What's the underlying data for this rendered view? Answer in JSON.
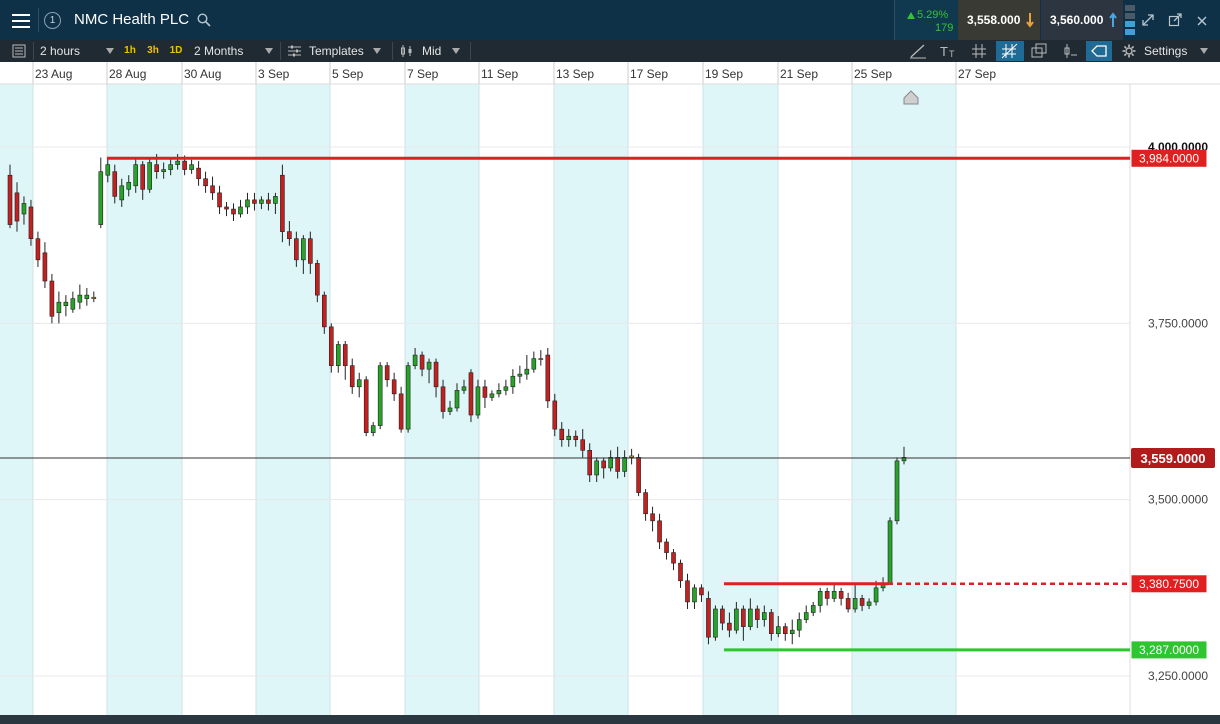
{
  "header": {
    "menu_icon": "hamburger-menu-icon",
    "window_number": "1",
    "title": "NMC Health PLC",
    "search_icon": "search-icon",
    "change_percent": "5.29%",
    "change_points": "179",
    "sell_price": "3,558.000",
    "buy_price": "3,560.000",
    "colors": {
      "bg": "#0e3147",
      "up": "#36c236",
      "sell": "#e8a23c",
      "buy": "#4aa8e0"
    }
  },
  "toolbar": {
    "interval": "2 hours",
    "timeframes": [
      "1h",
      "3h",
      "1D"
    ],
    "range": "2 Months",
    "templates": "Templates",
    "price_type": "Mid",
    "settings": "Settings"
  },
  "chart_data": {
    "type": "candlestick",
    "x_tick_labels": [
      "23 Aug",
      "28 Aug",
      "30 Aug",
      "3 Sep",
      "5 Sep",
      "7 Sep",
      "11 Sep",
      "13 Sep",
      "17 Sep",
      "19 Sep",
      "21 Sep",
      "25 Sep",
      "27 Sep"
    ],
    "y_ticks": [
      {
        "value": 4000,
        "label": "4,000.0000"
      },
      {
        "value": 3750,
        "label": "3,750.0000"
      },
      {
        "value": 3500,
        "label": "3,500.0000"
      },
      {
        "value": 3250,
        "label": "3,250.0000"
      }
    ],
    "ylim": [
      3195,
      4090
    ],
    "current_price": {
      "value": 3559,
      "label": "3,559.0000",
      "color": "#b11b1b"
    },
    "levels": [
      {
        "value": 3984,
        "label": "3,984.0000",
        "color": "#e02020",
        "style": "solid"
      },
      {
        "value": 3380.75,
        "label": "3,380.7500",
        "color": "#e02020",
        "style": "solid-then-dashed"
      },
      {
        "value": 3287,
        "label": "3,287.0000",
        "color": "#2ec52e",
        "style": "solid"
      }
    ],
    "candles": [
      [
        3960,
        3890,
        3975,
        3885
      ],
      [
        3935,
        3895,
        3950,
        3880
      ],
      [
        3905,
        3920,
        3930,
        3890
      ],
      [
        3915,
        3870,
        3925,
        3860
      ],
      [
        3870,
        3840,
        3880,
        3830
      ],
      [
        3850,
        3810,
        3865,
        3800
      ],
      [
        3810,
        3760,
        3820,
        3750
      ],
      [
        3765,
        3780,
        3795,
        3750
      ],
      [
        3775,
        3780,
        3790,
        3760
      ],
      [
        3770,
        3785,
        3795,
        3765
      ],
      [
        3780,
        3790,
        3805,
        3770
      ],
      [
        3785,
        3790,
        3800,
        3775
      ],
      [
        3785,
        3787,
        3795,
        3780
      ],
      [
        3890,
        3965,
        3985,
        3885
      ],
      [
        3960,
        3975,
        3985,
        3950
      ],
      [
        3965,
        3930,
        3975,
        3920
      ],
      [
        3925,
        3945,
        3955,
        3915
      ],
      [
        3940,
        3950,
        3960,
        3930
      ],
      [
        3945,
        3975,
        3985,
        3935
      ],
      [
        3975,
        3940,
        3980,
        3925
      ],
      [
        3940,
        3978,
        3985,
        3935
      ],
      [
        3975,
        3965,
        3990,
        3955
      ],
      [
        3965,
        3968,
        3978,
        3955
      ],
      [
        3968,
        3975,
        3985,
        3960
      ],
      [
        3975,
        3980,
        3990,
        3968
      ],
      [
        3980,
        3968,
        3988,
        3960
      ],
      [
        3968,
        3975,
        3982,
        3962
      ],
      [
        3970,
        3955,
        3980,
        3945
      ],
      [
        3955,
        3945,
        3965,
        3935
      ],
      [
        3945,
        3935,
        3958,
        3925
      ],
      [
        3935,
        3915,
        3945,
        3905
      ],
      [
        3915,
        3912,
        3922,
        3902
      ],
      [
        3912,
        3905,
        3920,
        3895
      ],
      [
        3905,
        3915,
        3925,
        3900
      ],
      [
        3915,
        3925,
        3935,
        3905
      ],
      [
        3925,
        3920,
        3935,
        3910
      ],
      [
        3920,
        3925,
        3930,
        3912
      ],
      [
        3925,
        3920,
        3935,
        3910
      ],
      [
        3920,
        3930,
        3935,
        3905
      ],
      [
        3960,
        3880,
        3975,
        3865
      ],
      [
        3880,
        3870,
        3895,
        3860
      ],
      [
        3870,
        3840,
        3880,
        3830
      ],
      [
        3840,
        3870,
        3875,
        3820
      ],
      [
        3870,
        3835,
        3880,
        3820
      ],
      [
        3835,
        3790,
        3840,
        3780
      ],
      [
        3790,
        3745,
        3795,
        3735
      ],
      [
        3745,
        3690,
        3750,
        3680
      ],
      [
        3690,
        3720,
        3725,
        3680
      ],
      [
        3720,
        3690,
        3725,
        3670
      ],
      [
        3690,
        3660,
        3700,
        3650
      ],
      [
        3660,
        3670,
        3680,
        3645
      ],
      [
        3670,
        3595,
        3675,
        3590
      ],
      [
        3595,
        3605,
        3610,
        3590
      ],
      [
        3605,
        3690,
        3695,
        3600
      ],
      [
        3690,
        3670,
        3695,
        3660
      ],
      [
        3670,
        3650,
        3680,
        3640
      ],
      [
        3650,
        3600,
        3660,
        3595
      ],
      [
        3600,
        3690,
        3695,
        3595
      ],
      [
        3690,
        3705,
        3715,
        3685
      ],
      [
        3705,
        3685,
        3710,
        3675
      ],
      [
        3685,
        3695,
        3700,
        3665
      ],
      [
        3695,
        3660,
        3700,
        3645
      ],
      [
        3660,
        3625,
        3670,
        3615
      ],
      [
        3625,
        3630,
        3640,
        3620
      ],
      [
        3630,
        3655,
        3665,
        3625
      ],
      [
        3655,
        3660,
        3670,
        3650
      ],
      [
        3680,
        3620,
        3685,
        3610
      ],
      [
        3620,
        3660,
        3670,
        3615
      ],
      [
        3660,
        3645,
        3670,
        3630
      ],
      [
        3645,
        3650,
        3655,
        3640
      ],
      [
        3650,
        3655,
        3665,
        3645
      ],
      [
        3655,
        3660,
        3670,
        3648
      ],
      [
        3660,
        3675,
        3685,
        3650
      ],
      [
        3675,
        3678,
        3690,
        3665
      ],
      [
        3678,
        3685,
        3705,
        3670
      ],
      [
        3685,
        3700,
        3710,
        3680
      ],
      [
        3700,
        3700,
        3712,
        3690
      ],
      [
        3705,
        3640,
        3715,
        3630
      ],
      [
        3640,
        3600,
        3650,
        3590
      ],
      [
        3600,
        3585,
        3610,
        3575
      ],
      [
        3585,
        3590,
        3600,
        3575
      ],
      [
        3590,
        3585,
        3598,
        3575
      ],
      [
        3585,
        3570,
        3600,
        3560
      ],
      [
        3570,
        3535,
        3580,
        3525
      ],
      [
        3535,
        3555,
        3560,
        3525
      ],
      [
        3555,
        3545,
        3560,
        3530
      ],
      [
        3545,
        3560,
        3570,
        3540
      ],
      [
        3560,
        3540,
        3575,
        3530
      ],
      [
        3540,
        3560,
        3570,
        3532
      ],
      [
        3560,
        3562,
        3572,
        3550
      ],
      [
        3560,
        3510,
        3565,
        3505
      ],
      [
        3510,
        3480,
        3515,
        3470
      ],
      [
        3480,
        3470,
        3490,
        3455
      ],
      [
        3470,
        3440,
        3480,
        3430
      ],
      [
        3440,
        3425,
        3445,
        3415
      ],
      [
        3425,
        3410,
        3430,
        3400
      ],
      [
        3410,
        3385,
        3415,
        3375
      ],
      [
        3385,
        3355,
        3395,
        3345
      ],
      [
        3355,
        3375,
        3380,
        3345
      ],
      [
        3375,
        3365,
        3380,
        3355
      ],
      [
        3360,
        3305,
        3370,
        3295
      ],
      [
        3305,
        3345,
        3350,
        3300
      ],
      [
        3345,
        3325,
        3350,
        3315
      ],
      [
        3325,
        3315,
        3340,
        3305
      ],
      [
        3315,
        3345,
        3355,
        3310
      ],
      [
        3345,
        3320,
        3350,
        3300
      ],
      [
        3320,
        3345,
        3360,
        3315
      ],
      [
        3345,
        3330,
        3350,
        3318
      ],
      [
        3330,
        3340,
        3350,
        3320
      ],
      [
        3340,
        3310,
        3345,
        3300
      ],
      [
        3310,
        3320,
        3335,
        3305
      ],
      [
        3320,
        3310,
        3325,
        3300
      ],
      [
        3310,
        3315,
        3330,
        3295
      ],
      [
        3315,
        3330,
        3340,
        3305
      ],
      [
        3330,
        3340,
        3350,
        3325
      ],
      [
        3340,
        3350,
        3355,
        3335
      ],
      [
        3350,
        3370,
        3375,
        3340
      ],
      [
        3370,
        3360,
        3375,
        3350
      ],
      [
        3360,
        3370,
        3380,
        3355
      ],
      [
        3370,
        3360,
        3375,
        3350
      ],
      [
        3360,
        3345,
        3368,
        3340
      ],
      [
        3345,
        3360,
        3380,
        3340
      ],
      [
        3360,
        3350,
        3365,
        3342
      ],
      [
        3350,
        3355,
        3360,
        3345
      ],
      [
        3355,
        3375,
        3385,
        3350
      ],
      [
        3375,
        3380,
        3390,
        3370
      ],
      [
        3380,
        3470,
        3475,
        3380
      ],
      [
        3470,
        3555,
        3560,
        3465
      ],
      [
        3555,
        3560,
        3575,
        3550
      ]
    ]
  }
}
